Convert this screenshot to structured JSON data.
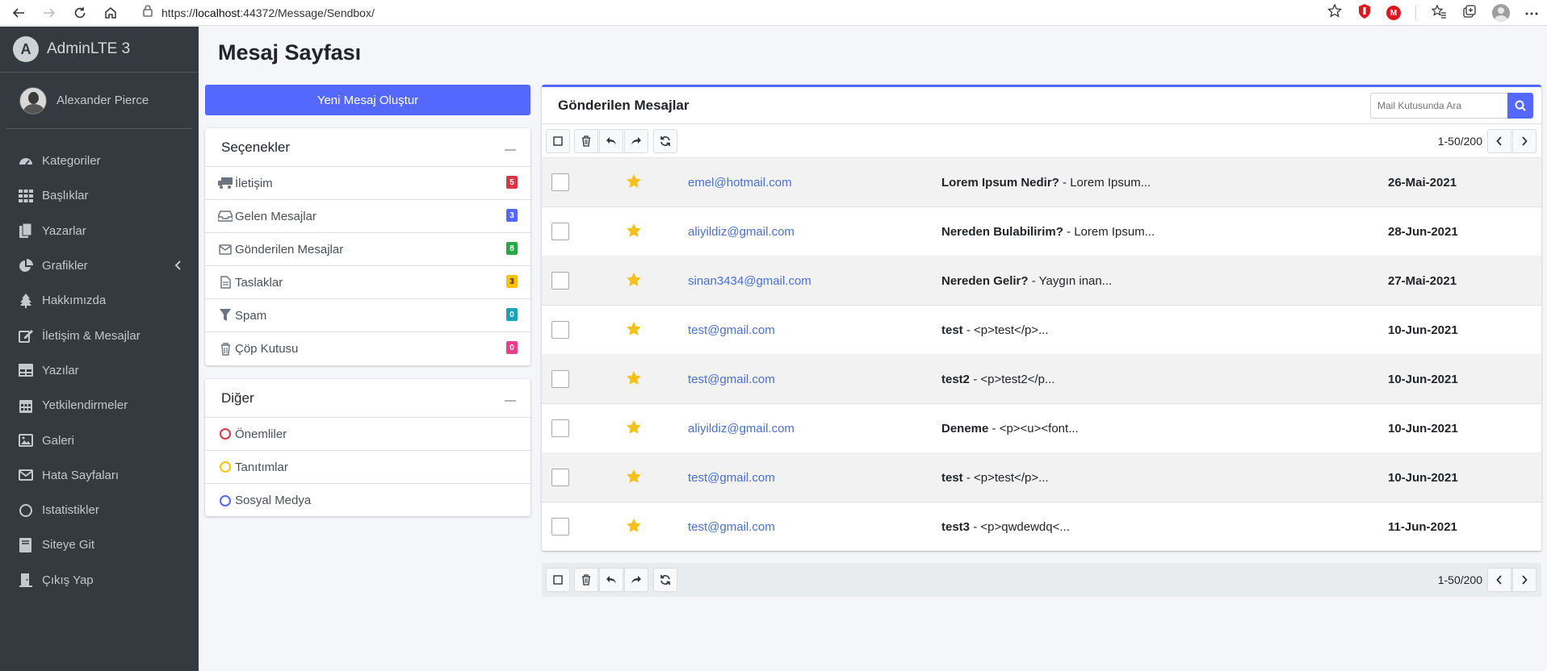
{
  "browser": {
    "url_prefix": "https://",
    "url_host": "localhost",
    "url_rest": ":44372/Message/Sendbox/",
    "ext_badge": "M"
  },
  "sidebar": {
    "brand": "AdminLTE 3",
    "brand_logo_letter": "A",
    "user": "Alexander Pierce",
    "items": [
      {
        "label": "Kategoriler",
        "icon": "dashboard-icon"
      },
      {
        "label": "Başlıklar",
        "icon": "grid-icon"
      },
      {
        "label": "Yazarlar",
        "icon": "copy-icon"
      },
      {
        "label": "Grafikler",
        "icon": "pie-chart-icon"
      },
      {
        "label": "Hakkımızda",
        "icon": "tree-icon"
      },
      {
        "label": "İletişim & Mesajlar",
        "icon": "edit-icon"
      },
      {
        "label": "Yazılar",
        "icon": "table-icon"
      },
      {
        "label": "Yetkilendirmeler",
        "icon": "calendar-icon"
      },
      {
        "label": "Galeri",
        "icon": "image-icon"
      },
      {
        "label": "Hata Sayfaları",
        "icon": "envelope-icon"
      },
      {
        "label": "Istatistikler",
        "icon": "circle-icon"
      },
      {
        "label": "Siteye Git",
        "icon": "book-icon"
      },
      {
        "label": "Çıkış Yap",
        "icon": "door-icon"
      }
    ]
  },
  "page": {
    "title": "Mesaj Sayfası",
    "compose_button": "Yeni Mesaj Oluştur"
  },
  "options": {
    "title": "Seçenekler",
    "items": [
      {
        "label": "İletişim",
        "count": "5",
        "color": "#dc3545"
      },
      {
        "label": "Gelen Mesajlar",
        "count": "3",
        "color": "#5468ff"
      },
      {
        "label": "Gönderilen Mesajlar",
        "count": "8",
        "color": "#28a745"
      },
      {
        "label": "Taslaklar",
        "count": "3",
        "color": "#ffc107"
      },
      {
        "label": "Spam",
        "count": "0",
        "color": "#17a2b8"
      },
      {
        "label": "Çöp Kutusu",
        "count": "0",
        "color": "#e83e8c"
      }
    ]
  },
  "other": {
    "title": "Diğer",
    "items": [
      {
        "label": "Önemliler",
        "color": "#dc3545"
      },
      {
        "label": "Tanıtımlar",
        "color": "#ffc107"
      },
      {
        "label": "Sosyal Medya",
        "color": "#5468ff"
      }
    ]
  },
  "mailbox": {
    "title": "Gönderilen Mesajlar",
    "search_placeholder": "Mail Kutusunda Ara",
    "pager": "1-50/200",
    "rows": [
      {
        "from": "emel@hotmail.com",
        "subject": "Lorem Ipsum Nedir?",
        "preview": " - Lorem Ipsum...",
        "date": "26-Mai-2021"
      },
      {
        "from": "aliyildiz@gmail.com",
        "subject": "Nereden Bulabilirim?",
        "preview": " - Lorem Ipsum...",
        "date": "28-Jun-2021"
      },
      {
        "from": "sinan3434@gmail.com",
        "subject": "Nereden Gelir?",
        "preview": " - Yaygın inan...",
        "date": "27-Mai-2021"
      },
      {
        "from": "test@gmail.com",
        "subject": "test",
        "preview": " - <p>test</p>...",
        "date": "10-Jun-2021"
      },
      {
        "from": "test@gmail.com",
        "subject": "test2",
        "preview": " - <p>test2</p...",
        "date": "10-Jun-2021"
      },
      {
        "from": "aliyildiz@gmail.com",
        "subject": "Deneme",
        "preview": " - <p><u><font...",
        "date": "10-Jun-2021"
      },
      {
        "from": "test@gmail.com",
        "subject": "test",
        "preview": " - <p>test</p>...",
        "date": "10-Jun-2021"
      },
      {
        "from": "test@gmail.com",
        "subject": "test3",
        "preview": " - <p>qwdewdq<...",
        "date": "11-Jun-2021"
      }
    ]
  },
  "colors": {
    "primary": "#5468ff",
    "sidebar": "#343a40",
    "star": "#f4c01e"
  }
}
